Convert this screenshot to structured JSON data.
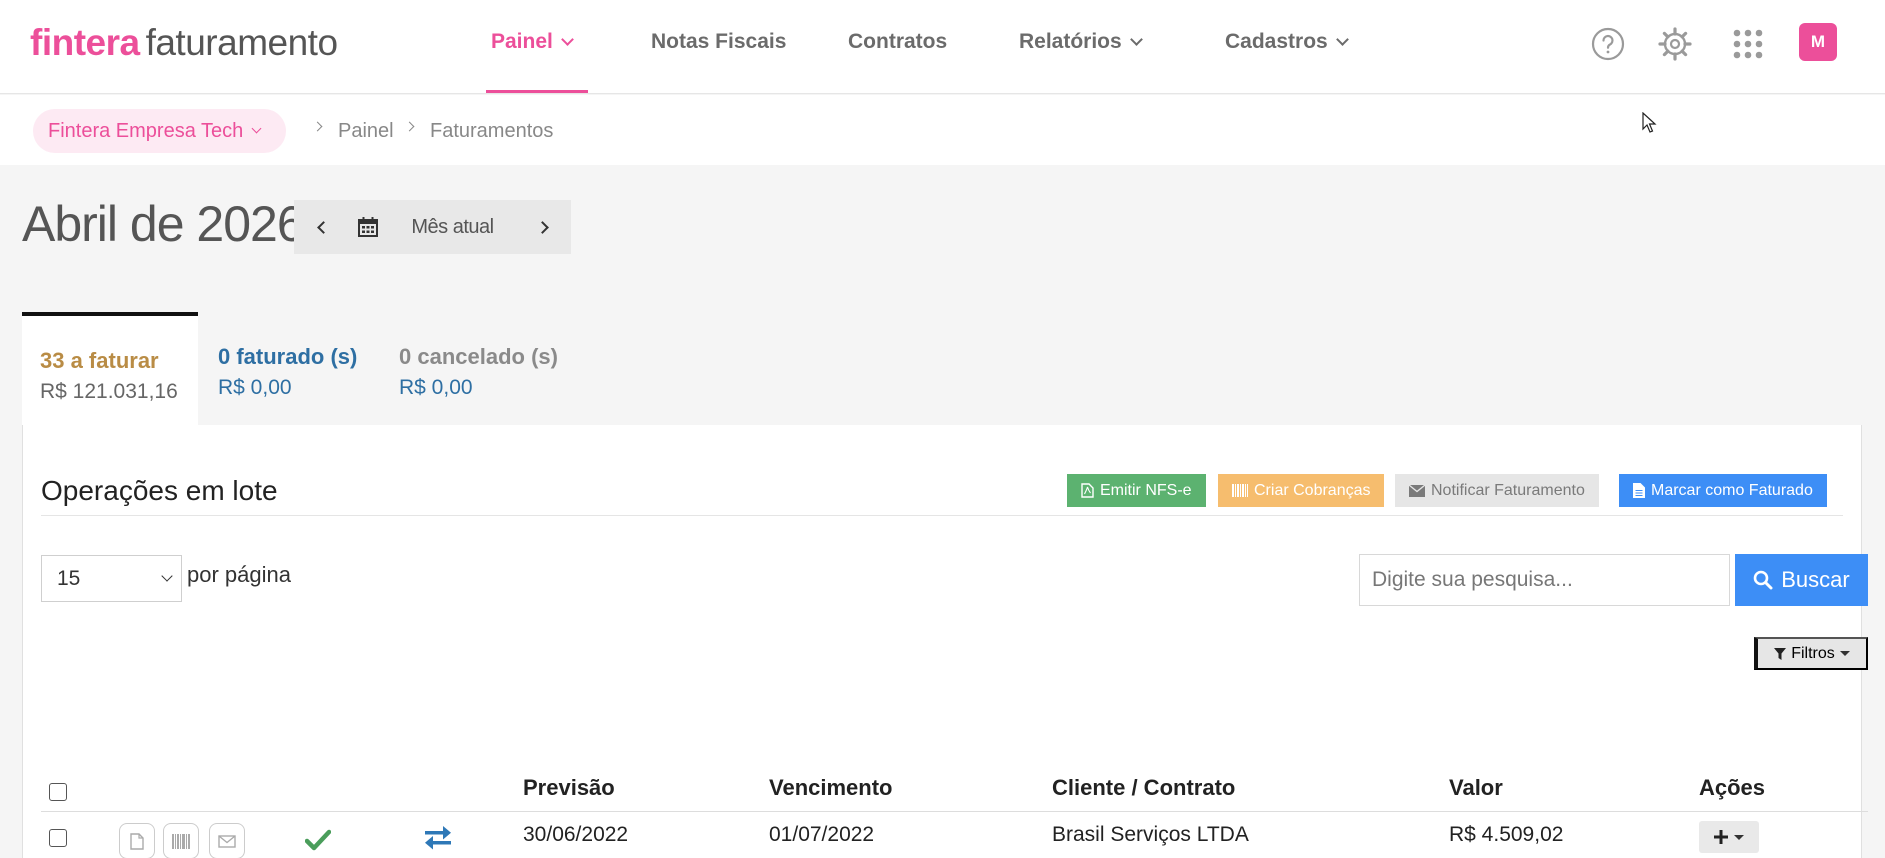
{
  "app": {
    "brand": "fintera",
    "product": "faturamento"
  },
  "nav": {
    "items": [
      {
        "label": "Painel",
        "active": true,
        "dropdown": true
      },
      {
        "label": "Notas Fiscais",
        "active": false,
        "dropdown": false
      },
      {
        "label": "Contratos",
        "active": false,
        "dropdown": false
      },
      {
        "label": "Relatórios",
        "active": false,
        "dropdown": true
      },
      {
        "label": "Cadastros",
        "active": false,
        "dropdown": true
      }
    ],
    "avatar_initial": "M"
  },
  "breadcrumb": {
    "company": "Fintera Empresa Tech",
    "items": [
      "Painel",
      "Faturamentos"
    ]
  },
  "period": {
    "title": "Abril de 2026",
    "current_label": "Mês atual"
  },
  "tabs": [
    {
      "count": "33 a faturar",
      "amount": "R$ 121.031,16",
      "count_color": "#b98c45",
      "amount_color": "#666666"
    },
    {
      "count": "0 faturado (s)",
      "amount": "R$ 0,00",
      "count_color": "#2e6fa3",
      "amount_color": "#2e6fa3"
    },
    {
      "count": "0 cancelado (s)",
      "amount": "R$ 0,00",
      "count_color": "#8a8a8a",
      "amount_color": "#2e6fa3"
    }
  ],
  "batch": {
    "title": "Operações em lote",
    "buttons": [
      {
        "label": "Emitir NFS-e",
        "icon": "file-pdf-icon",
        "bg": "#5cb270",
        "fg": "#ffffff"
      },
      {
        "label": "Criar Cobranças",
        "icon": "barcode-icon",
        "bg": "#f6bd6e",
        "fg": "#ffffff"
      },
      {
        "label": "Notificar Faturamento",
        "icon": "envelope-icon",
        "bg": "#e6e6e6",
        "fg": "#7a7a7a"
      },
      {
        "label": "Marcar como Faturado",
        "icon": "file-icon",
        "bg": "#3d8ef6",
        "fg": "#ffffff"
      }
    ]
  },
  "list": {
    "per_page_value": "15",
    "per_page_label": "por página",
    "search_placeholder": "Digite sua pesquisa...",
    "search_button": "Buscar",
    "filters_label": "Filtros"
  },
  "table": {
    "headers": [
      "Previsão",
      "Vencimento",
      "Cliente / Contrato",
      "Valor",
      "Ações"
    ],
    "rows": [
      {
        "previsao": "30/06/2022",
        "vencimento": "01/07/2022",
        "cliente": "Brasil Serviços LTDA",
        "valor": "R$ 4.509,02",
        "status": "check-icon",
        "recurrence": "exchange-icon"
      }
    ]
  },
  "colors": {
    "brand_pink": "#ec4f9a",
    "primary_blue": "#3d8ef6",
    "success_green": "#4a9d5b"
  }
}
